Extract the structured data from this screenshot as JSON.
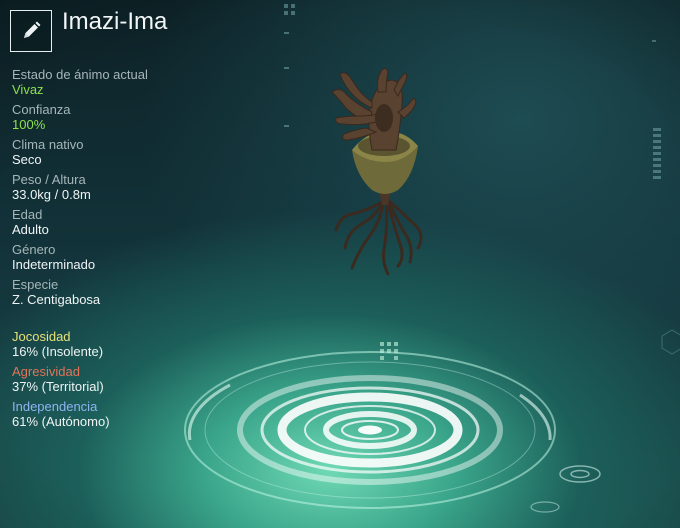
{
  "creature": {
    "name": "Imazi-Ima"
  },
  "edit_button": {
    "icon": "pencil-icon"
  },
  "stats": [
    {
      "label": "Estado de ánimo actual",
      "value": "Vivaz",
      "highlight": true
    },
    {
      "label": "Confianza",
      "value": "100%",
      "highlight": true
    },
    {
      "label": "Clima nativo",
      "value": "Seco",
      "highlight": false
    },
    {
      "label": "Peso / Altura",
      "value": "33.0kg / 0.8m",
      "highlight": false
    },
    {
      "label": "Edad",
      "value": "Adulto",
      "highlight": false
    },
    {
      "label": "Género",
      "value": "Indeterminado",
      "highlight": false
    },
    {
      "label": "Especie",
      "value": "Z. Centigabosa",
      "highlight": false
    }
  ],
  "traits": [
    {
      "label": "Jocosidad",
      "value": "16% (Insolente)",
      "color": "#e6e07a"
    },
    {
      "label": "Agresividad",
      "value": "37% (Territorial)",
      "color": "#e0745a"
    },
    {
      "label": "Independencia",
      "value": "61% (Autónomo)",
      "color": "#8fb4f0"
    }
  ],
  "colors": {
    "accent_green": "#8de04d",
    "label_gray": "#a6b6b8"
  }
}
